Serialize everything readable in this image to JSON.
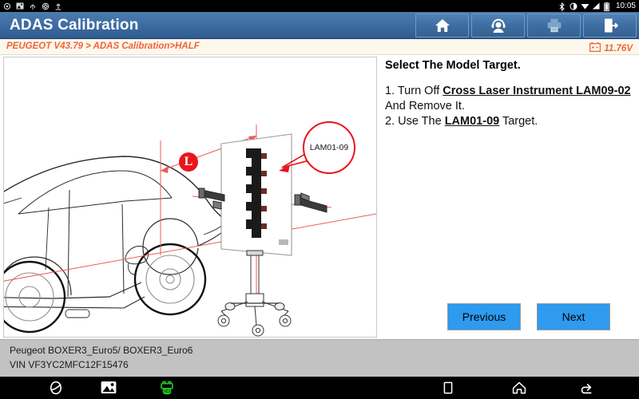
{
  "status_bar": {
    "left_icons": [
      "sync-icon",
      "screenshot-icon",
      "usb-icon",
      "settings-icon",
      "upload-icon"
    ],
    "right_icons": [
      "bluetooth-icon",
      "brightness-icon",
      "wifi-icon",
      "signal-icon",
      "battery-icon"
    ],
    "clock": "10:05"
  },
  "header": {
    "title": "ADAS Calibration",
    "buttons": [
      {
        "name": "home-button",
        "icon": "home-icon",
        "enabled": true
      },
      {
        "name": "support-button",
        "icon": "headset-person-icon",
        "enabled": true
      },
      {
        "name": "print-button",
        "icon": "printer-icon",
        "enabled": false
      },
      {
        "name": "exit-button",
        "icon": "exit-door-icon",
        "enabled": true
      }
    ]
  },
  "breadcrumb": {
    "text": "PEUGEOT V43.79 > ADAS Calibration>HALF",
    "color": "#f0643c"
  },
  "battery": {
    "icon": "car-battery-icon",
    "voltage": "11.76V"
  },
  "diagram": {
    "name": "adas-calibration-diagram",
    "marker_label": "L",
    "callout_label": "LAM01-09",
    "elements": [
      "vehicle-line-art",
      "calibration-target-board",
      "checkerboard-pattern",
      "cross-laser-instrument-left",
      "cross-laser-instrument-right",
      "laser-line",
      "tripod-stand",
      "dimension-arrows"
    ]
  },
  "instructions": {
    "heading": "Select The Model Target.",
    "step1_prefix": "1. Turn Off ",
    "step1_emphasis": "Cross Laser Instrument LAM09-02",
    "step1_suffix": " And Remove It.",
    "step2_prefix": "2. Use The ",
    "step2_emphasis": "LAM01-09",
    "step2_suffix": " Target."
  },
  "actions": {
    "previous_label": "Previous",
    "next_label": "Next",
    "button_color": "#2e9bef"
  },
  "vehicle_info": {
    "model": "Peugeot BOXER3_Euro5/ BOXER3_Euro6",
    "vin": "VIN VF3YC2MFC12F15476"
  },
  "nav_bar": {
    "items": [
      {
        "name": "browser-icon"
      },
      {
        "name": "gallery-image-icon"
      },
      {
        "name": "vci-connector-icon",
        "color": "#22c522"
      },
      {
        "name": "recents-square-icon"
      },
      {
        "name": "home-icon"
      },
      {
        "name": "back-arrow-icon"
      }
    ]
  }
}
